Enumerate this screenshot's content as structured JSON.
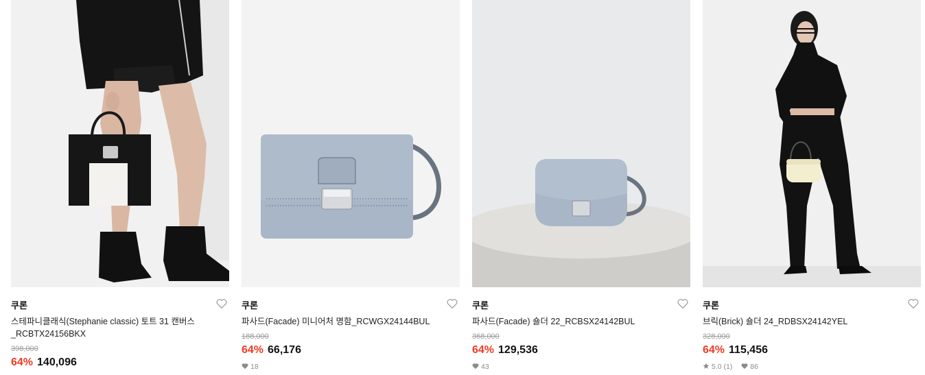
{
  "products": [
    {
      "brand": "쿠론",
      "name": "스테파니클래식(Stephanie classic) 토트 31 캔버스_RCBTX24156BKX",
      "original_price": "398,000",
      "discount": "64%",
      "price": "140,096",
      "rating": "",
      "likes": ""
    },
    {
      "brand": "쿠론",
      "name": "파사드(Facade) 미니어처 명함_RCWGX24144BUL",
      "original_price": "188,000",
      "discount": "64%",
      "price": "66,176",
      "rating": "",
      "likes": "18"
    },
    {
      "brand": "쿠론",
      "name": "파사드(Facade) 숄더 22_RCBSX24142BUL",
      "original_price": "368,000",
      "discount": "64%",
      "price": "129,536",
      "rating": "",
      "likes": "43"
    },
    {
      "brand": "쿠론",
      "name": "브릭(Brick) 숄더 24_RDBSX24142YEL",
      "original_price": "328,000",
      "discount": "64%",
      "price": "115,456",
      "rating": "5.0 (1)",
      "likes": "86"
    }
  ],
  "icons": {
    "wishlist": "heart-outline-icon",
    "likes": "heart-filled-icon",
    "rating": "star-icon"
  },
  "colors": {
    "discount": "#ef3b24",
    "original_price": "#9a9a9a",
    "text": "#111111",
    "bag_blue": "#a9b6c7"
  }
}
